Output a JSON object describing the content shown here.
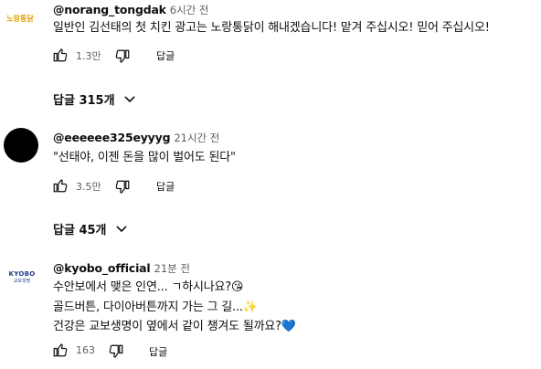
{
  "comments": [
    {
      "avatar_text": "노랑통닭",
      "handle": "@norang_tongdak",
      "time": "6시간 전",
      "lines": [
        "일반인 김선태의 첫 치킨 광고는 노랑통닭이 해내겠습니다! 맡겨 주십시오! 믿어 주십시오!"
      ],
      "likes": "1.3만",
      "reply_label": "답글",
      "replies_label": "답글 315개"
    },
    {
      "handle": "@eeeeee325eyyyg",
      "time": "21시간 전",
      "lines": [
        "\"선태야, 이젠 돈을 많이 벌어도 된다\""
      ],
      "likes": "3.5만",
      "reply_label": "답글",
      "replies_label": "답글 45개"
    },
    {
      "avatar_text": "KYOBO",
      "avatar_sub": "교보생명",
      "handle": "@kyobo_official",
      "time": "21분 전",
      "lines": [
        "수안보에서 맺은 인연... ㄱ하시나요?😘",
        "골드버튼, 다이아버튼까지 가는 그 길...✨",
        "건강은 교보생명이 옆에서 같이 챙겨도 될까요?💙"
      ],
      "likes": "163",
      "reply_label": "답글"
    }
  ]
}
